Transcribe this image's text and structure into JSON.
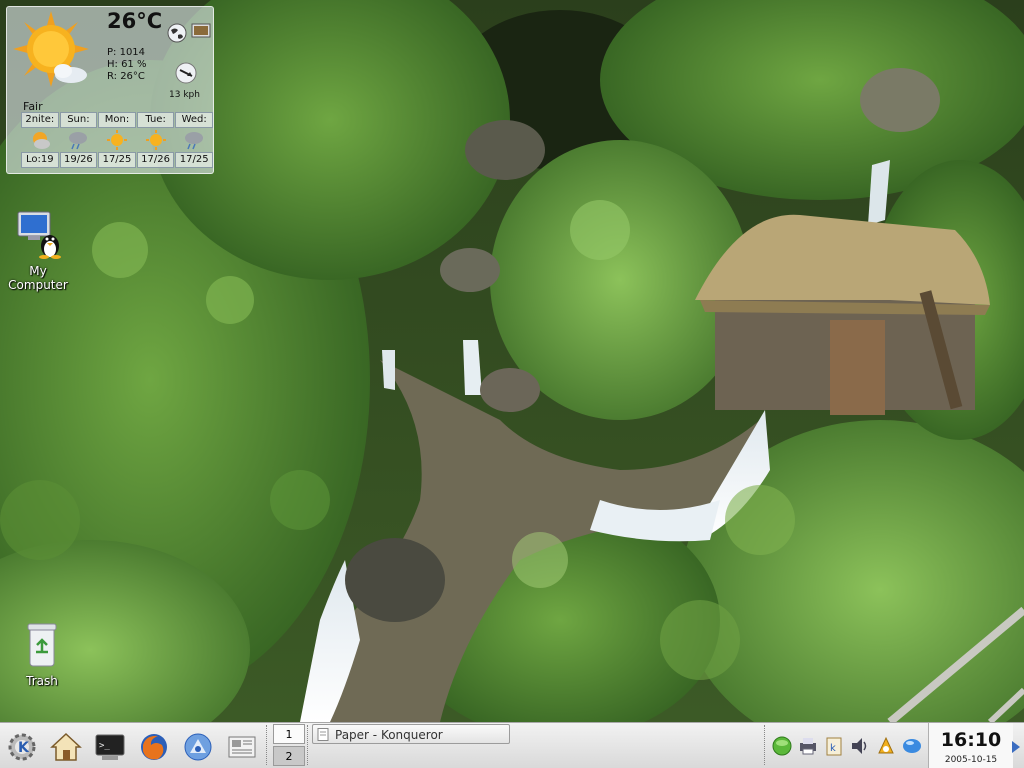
{
  "weather": {
    "temperature": "26°C",
    "pressure": "P: 1014",
    "humidity": "H: 61 %",
    "realfeel": "R: 26°C",
    "wind_speed": "13 kph",
    "condition": "Fair",
    "forecast": [
      {
        "day": "2nite:",
        "temps": "Lo:19",
        "icon": "moon-cloud-icon"
      },
      {
        "day": "Sun:",
        "temps": "19/26",
        "icon": "storm-cloud-icon"
      },
      {
        "day": "Mon:",
        "temps": "17/25",
        "icon": "sun-icon"
      },
      {
        "day": "Tue:",
        "temps": "17/26",
        "icon": "sun-icon"
      },
      {
        "day": "Wed:",
        "temps": "17/25",
        "icon": "storm-cloud-icon"
      }
    ]
  },
  "desktop": {
    "my_computer_label_1": "My",
    "my_computer_label_2": "Computer",
    "trash_label": "Trash"
  },
  "panel": {
    "launchers": [
      "kde-menu-icon",
      "home-icon",
      "terminal-icon",
      "firefox-icon",
      "konqueror-icon",
      "newspaper-icon"
    ],
    "pager": [
      "1",
      "2"
    ],
    "task_label": "Paper - Konqueror",
    "tray": [
      "network-icon",
      "printer-icon",
      "klipper-icon",
      "volume-icon",
      "kmix-icon",
      "updates-icon"
    ],
    "clock_time": "16:10",
    "clock_date": "2005-10-15"
  },
  "colors": {
    "panel_bg": "#e4e4e4",
    "accent": "#3a6cc0"
  }
}
